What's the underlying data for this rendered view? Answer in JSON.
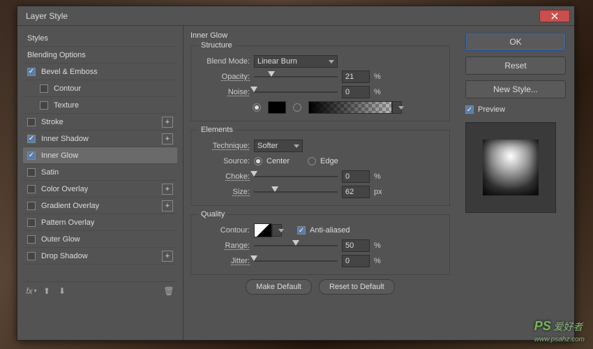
{
  "dialog": {
    "title": "Layer Style"
  },
  "sidebar": {
    "styles_label": "Styles",
    "blending_label": "Blending Options",
    "items": [
      {
        "label": "Bevel & Emboss",
        "checked": true,
        "plus": false
      },
      {
        "label": "Contour",
        "checked": false,
        "indent": true
      },
      {
        "label": "Texture",
        "checked": false,
        "indent": true
      },
      {
        "label": "Stroke",
        "checked": false,
        "plus": true
      },
      {
        "label": "Inner Shadow",
        "checked": true,
        "plus": true
      },
      {
        "label": "Inner Glow",
        "checked": true,
        "selected": true
      },
      {
        "label": "Satin",
        "checked": false
      },
      {
        "label": "Color Overlay",
        "checked": false,
        "plus": true
      },
      {
        "label": "Gradient Overlay",
        "checked": false,
        "plus": true
      },
      {
        "label": "Pattern Overlay",
        "checked": false
      },
      {
        "label": "Outer Glow",
        "checked": false
      },
      {
        "label": "Drop Shadow",
        "checked": false,
        "plus": true
      }
    ],
    "fx_label": "fx"
  },
  "panel": {
    "title": "Inner Glow",
    "structure": {
      "legend": "Structure",
      "blend_mode_label": "Blend Mode:",
      "blend_mode_value": "Linear Burn",
      "opacity_label": "Opacity:",
      "opacity_value": "21",
      "opacity_unit": "%",
      "noise_label": "Noise:",
      "noise_value": "0",
      "noise_unit": "%"
    },
    "elements": {
      "legend": "Elements",
      "technique_label": "Technique:",
      "technique_value": "Softer",
      "source_label": "Source:",
      "source_center": "Center",
      "source_edge": "Edge",
      "choke_label": "Choke:",
      "choke_value": "0",
      "choke_unit": "%",
      "size_label": "Size:",
      "size_value": "62",
      "size_unit": "px"
    },
    "quality": {
      "legend": "Quality",
      "contour_label": "Contour:",
      "antialiased_label": "Anti-aliased",
      "range_label": "Range:",
      "range_value": "50",
      "range_unit": "%",
      "jitter_label": "Jitter:",
      "jitter_value": "0",
      "jitter_unit": "%"
    },
    "make_default": "Make Default",
    "reset_default": "Reset to Default"
  },
  "right": {
    "ok": "OK",
    "reset": "Reset",
    "new_style": "New Style...",
    "preview": "Preview"
  },
  "watermark": "PS 爱好者 www.psahz.com"
}
